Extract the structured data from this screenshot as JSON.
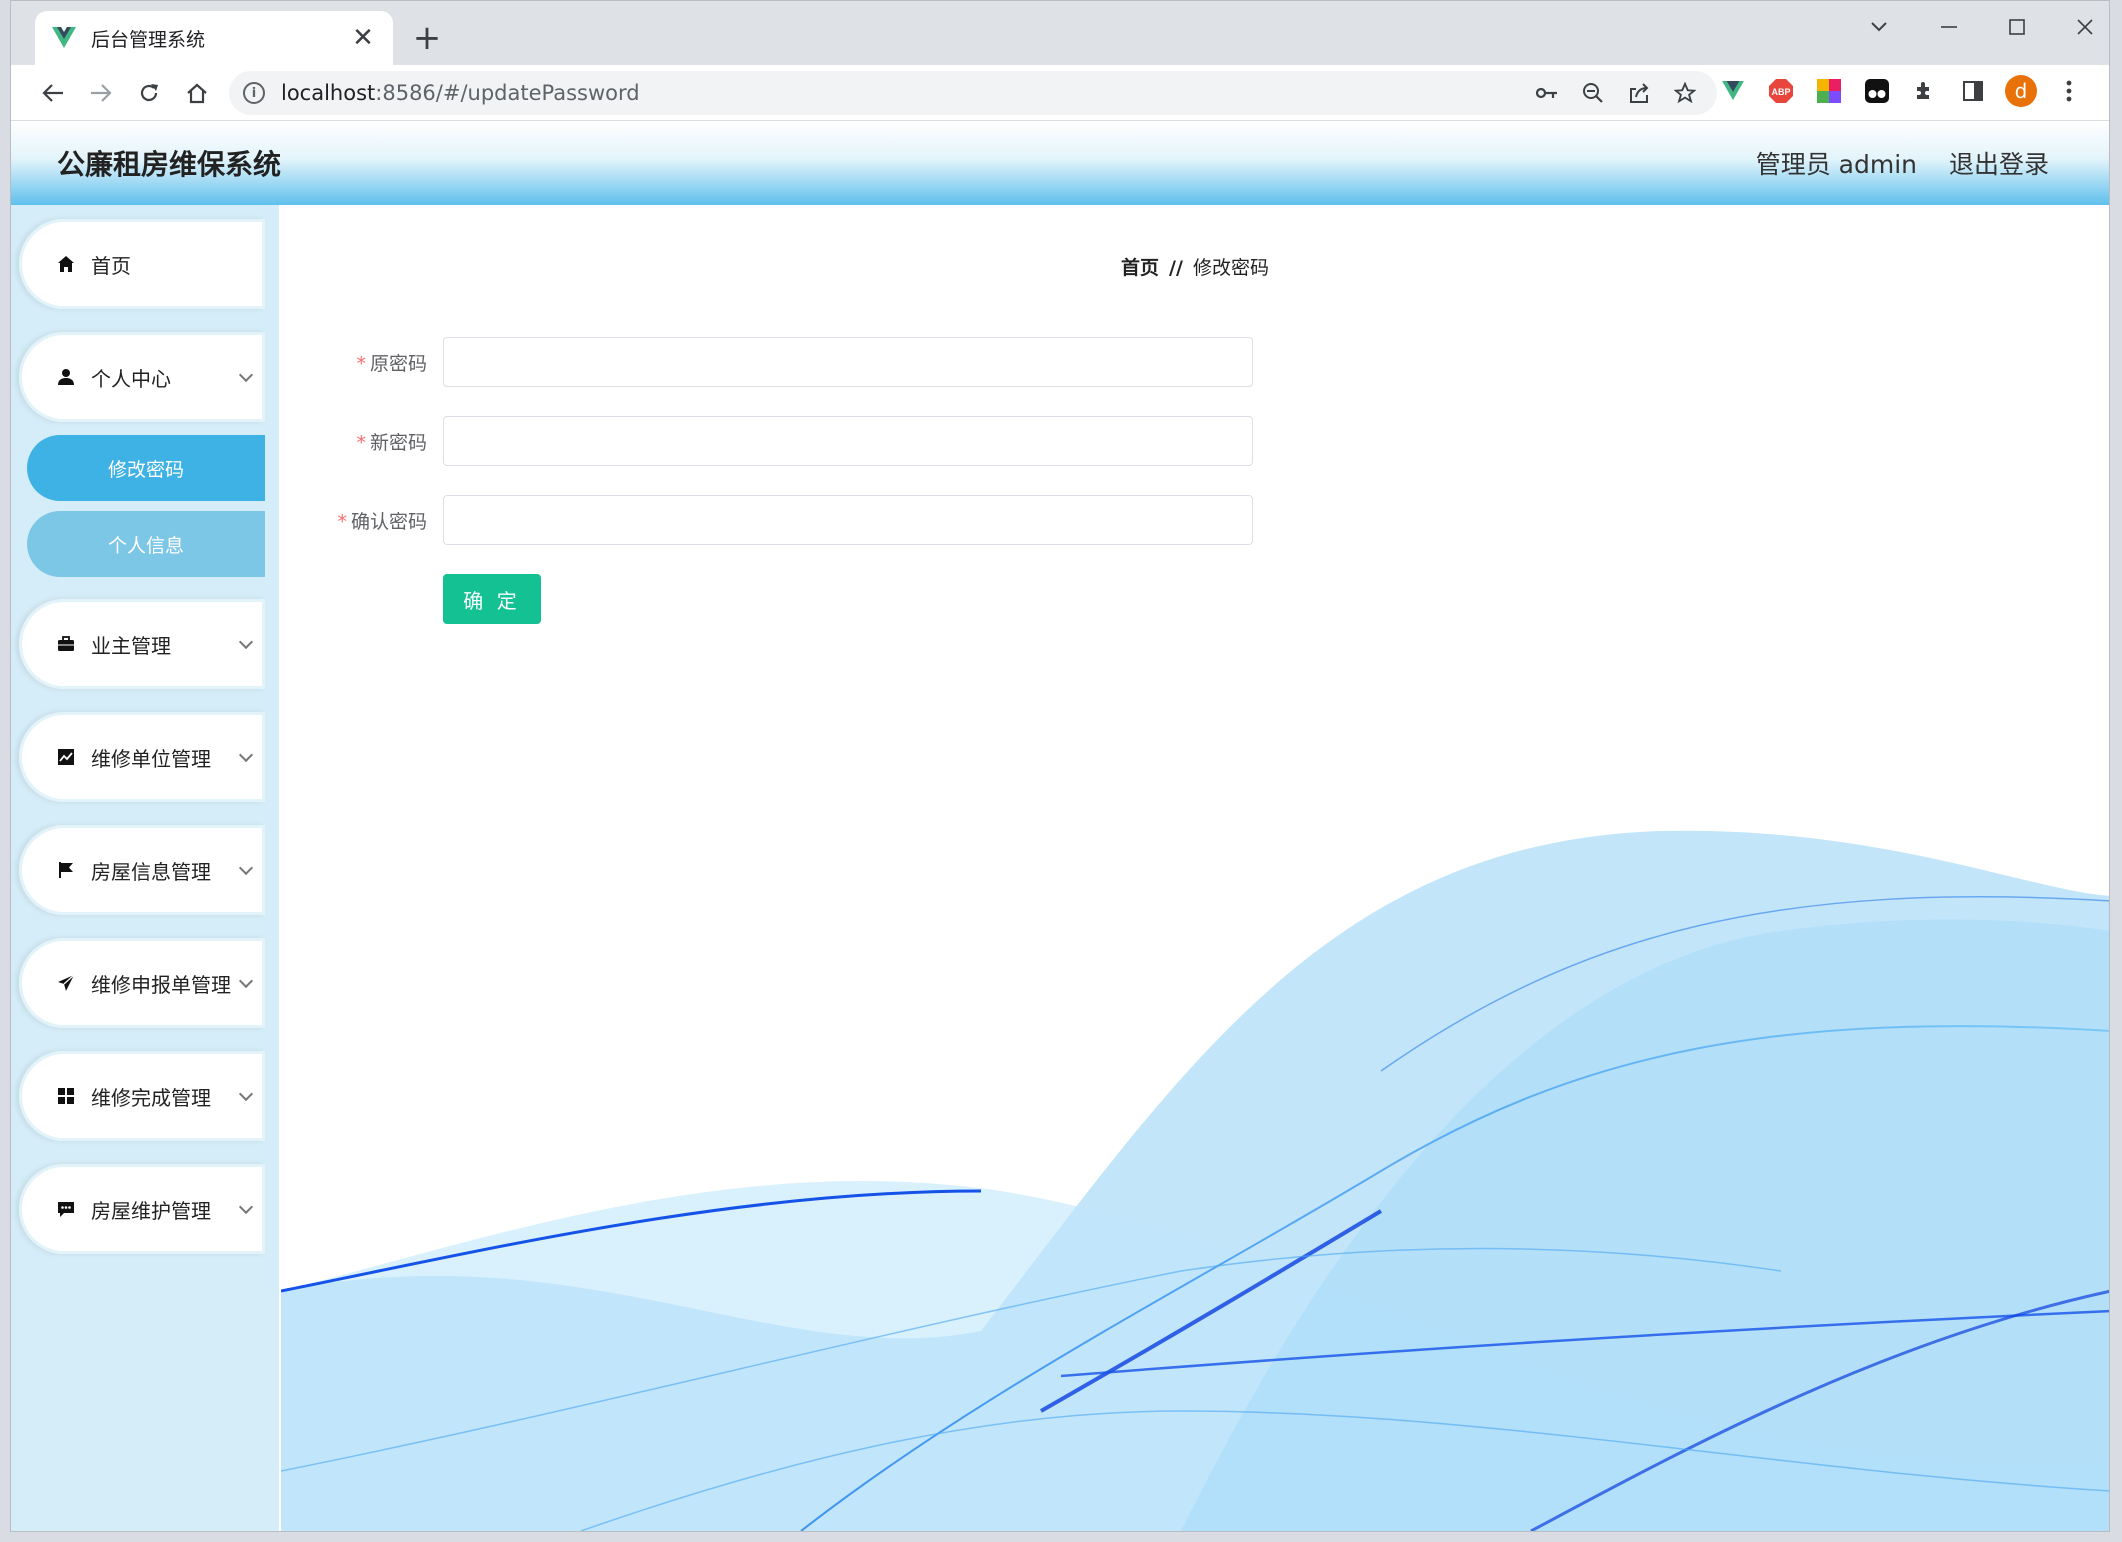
{
  "browser": {
    "tab_title": "后台管理系统",
    "url_host": "localhost",
    "url_rest": ":8586/#/updatePassword",
    "profile_initial": "d",
    "abp_label": "ABP"
  },
  "header": {
    "brand": "公廉租房维保系统",
    "user_label": "管理员 admin",
    "logout_label": "退出登录"
  },
  "sidebar": {
    "items": [
      {
        "label": "首页",
        "icon": "home-icon"
      },
      {
        "label": "个人中心",
        "icon": "user-icon"
      },
      {
        "label": "业主管理",
        "icon": "briefcase-icon"
      },
      {
        "label": "维修单位管理",
        "icon": "chart-icon"
      },
      {
        "label": "房屋信息管理",
        "icon": "flag-icon"
      },
      {
        "label": "维修申报单管理",
        "icon": "send-icon"
      },
      {
        "label": "维修完成管理",
        "icon": "grid-icon"
      },
      {
        "label": "房屋维护管理",
        "icon": "comment-icon"
      }
    ],
    "sub_items": [
      {
        "label": "修改密码",
        "active": true
      },
      {
        "label": "个人信息",
        "active": false
      }
    ]
  },
  "breadcrumb": {
    "home": "首页",
    "separator": "//",
    "current": "修改密码"
  },
  "form": {
    "required_mark": "*",
    "fields": [
      {
        "label": "原密码",
        "value": ""
      },
      {
        "label": "新密码",
        "value": ""
      },
      {
        "label": "确认密码",
        "value": ""
      }
    ],
    "submit_label": "确 定"
  },
  "colors": {
    "accent": "#3eb2e4",
    "submit": "#13c193",
    "sidebar_bg": "#d5edf8",
    "required": "#f56c6c"
  }
}
